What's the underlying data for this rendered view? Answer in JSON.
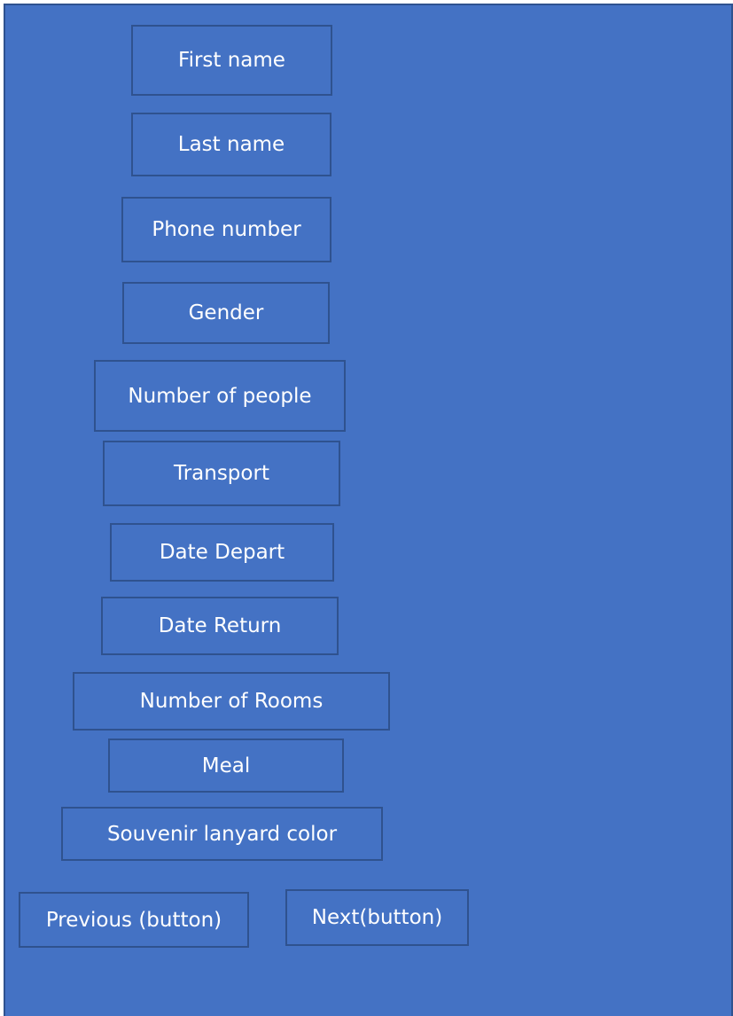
{
  "form": {
    "fields": [
      {
        "label": "First name"
      },
      {
        "label": "Last name"
      },
      {
        "label": "Phone number"
      },
      {
        "label": "Gender"
      },
      {
        "label": "Number of people"
      },
      {
        "label": "Transport"
      },
      {
        "label": "Date Depart"
      },
      {
        "label": "Date Return"
      },
      {
        "label": "Number of Rooms"
      },
      {
        "label": "Meal"
      },
      {
        "label": "Souvenir lanyard color"
      }
    ]
  },
  "nav": {
    "previous_label": "Previous (button)",
    "next_label": "Next(button)"
  },
  "colors": {
    "background": "#4472c4",
    "border": "#2f528f",
    "text": "#ffffff"
  }
}
